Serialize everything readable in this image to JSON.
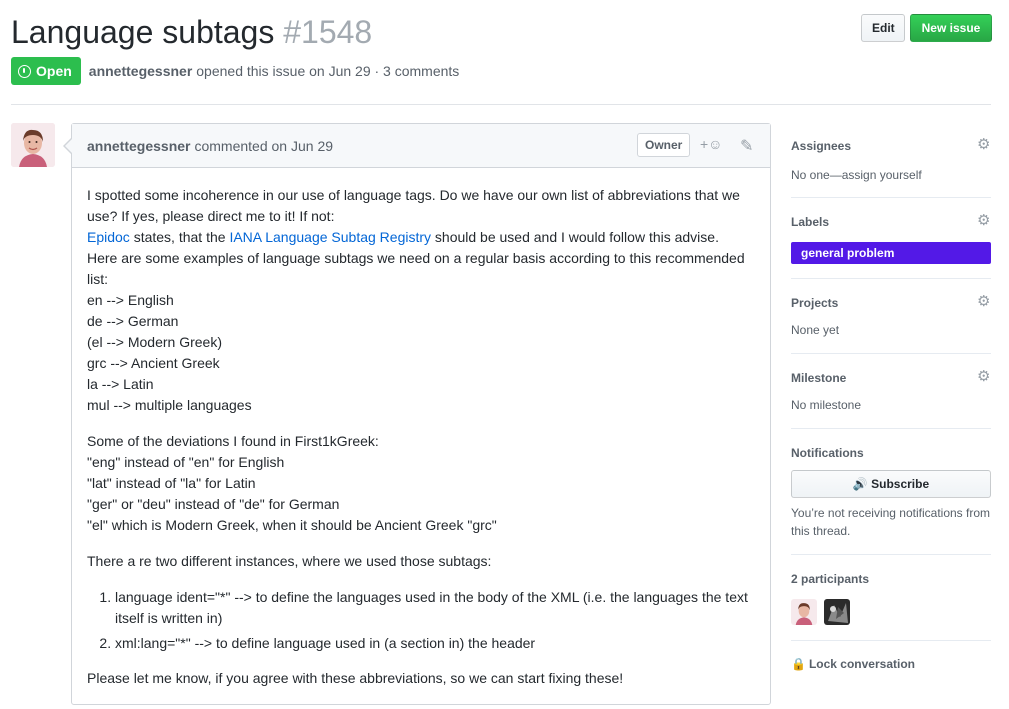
{
  "issue": {
    "title": "Language subtags",
    "number": "#1548",
    "state": "Open",
    "author": "annettegessner",
    "opened_text": "opened this issue on Jun 29 · 3 comments"
  },
  "header_buttons": {
    "edit": "Edit",
    "new_issue": "New issue"
  },
  "comment": {
    "author": "annettegessner",
    "date_text": "commented on Jun 29",
    "badge": "Owner",
    "paragraph1": {
      "line1": "I spotted some incoherence in our use of language tags. Do we have our own list of abbreviations that we use? If yes, please direct me to it! If not:",
      "link1": "Epidoc",
      "mid1": " states, that the ",
      "link2": "IANA Language Subtag Registry",
      "end1": " should be used and I would follow this advise.",
      "line3": "Here are some examples of language subtags we need on a regular basis according to this recommended list:",
      "items": [
        "en --> English",
        "de --> German",
        "(el --> Modern Greek)",
        "grc --> Ancient Greek",
        "la --> Latin",
        "mul --> multiple languages"
      ]
    },
    "paragraph2": {
      "intro": "Some of the deviations I found in First1kGreek:",
      "items": [
        "\"eng\" instead of \"en\" for English",
        "\"lat\" instead of \"la\" for Latin",
        "\"ger\" or \"deu\" instead of \"de\" for German",
        "\"el\" which is Modern Greek, when it should be Ancient Greek \"grc\""
      ]
    },
    "paragraph3": "There a re two different instances, where we used those subtags:",
    "list": [
      "language ident=\"*\" --> to define the languages used in the body of the XML (i.e. the languages the text itself is written in)",
      "xml:lang=\"*\" --> to define language used in (a section in) the header"
    ],
    "closing": "Please let me know, if you agree with these abbreviations, so we can start fixing these!"
  },
  "sidebar": {
    "assignees": {
      "heading": "Assignees",
      "value": "No one—assign yourself"
    },
    "labels": {
      "heading": "Labels",
      "label": "general problem",
      "label_color": "#5319e7"
    },
    "projects": {
      "heading": "Projects",
      "value": "None yet"
    },
    "milestone": {
      "heading": "Milestone",
      "value": "No milestone"
    },
    "notifications": {
      "heading": "Notifications",
      "button": "Subscribe",
      "note": "You’re not receiving notifications from this thread."
    },
    "participants": {
      "heading": "2 participants"
    },
    "lock": "Lock conversation"
  },
  "colors": {
    "open_green": "#2cbe4e",
    "link_blue": "#0366d6",
    "label_purple": "#5319e7"
  }
}
